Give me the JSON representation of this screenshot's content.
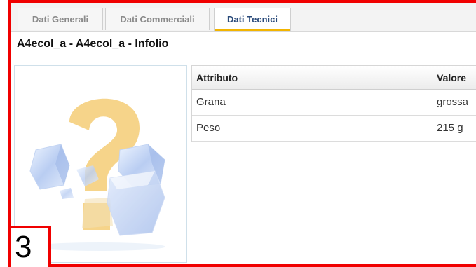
{
  "tabs": [
    {
      "label": "Dati Generali"
    },
    {
      "label": "Dati Commerciali"
    },
    {
      "label": "Dati Tecnici",
      "active": true
    }
  ],
  "product_title": "A4ecol_a - A4ecol_a - Infolio",
  "image": {
    "icon": "question-mark-placeholder-icon"
  },
  "table": {
    "headers": {
      "attribute": "Attributo",
      "value": "Valore"
    },
    "rows": [
      {
        "attribute": "Grana",
        "value": "grossa"
      },
      {
        "attribute": "Peso",
        "value": "215 g"
      }
    ]
  },
  "annotation": {
    "number": "3"
  },
  "colors": {
    "annotation": "#f00000",
    "active_tab_underline": "#f2b400",
    "active_tab_text": "#2a4a7a"
  }
}
